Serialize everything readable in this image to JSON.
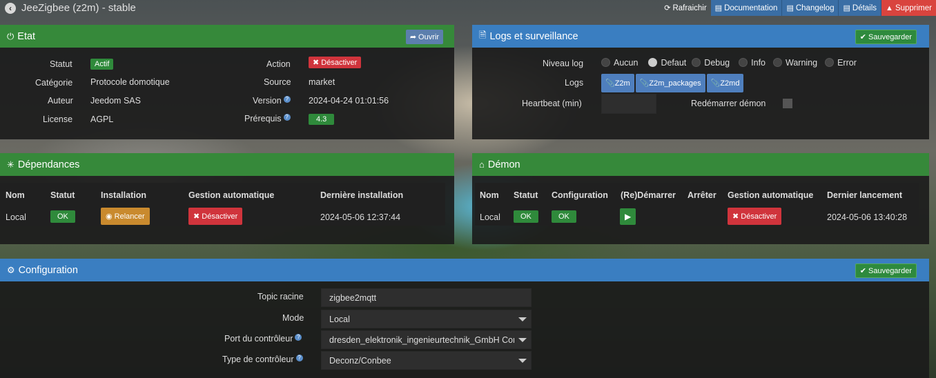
{
  "app": {
    "title": "JeeZigbee (z2m) - stable"
  },
  "toolbar": {
    "refresh": "Rafraichir",
    "documentation": "Documentation",
    "changelog": "Changelog",
    "details": "Détails",
    "delete": "Supprimer"
  },
  "etat": {
    "title": "Etat",
    "open_button": "Ouvrir",
    "statut_label": "Statut",
    "statut_value": "Actif",
    "categorie_label": "Catégorie",
    "categorie_value": "Protocole domotique",
    "auteur_label": "Auteur",
    "auteur_value": "Jeedom SAS",
    "license_label": "License",
    "license_value": "AGPL",
    "action_label": "Action",
    "action_button": "Désactiver",
    "source_label": "Source",
    "source_value": "market",
    "version_label": "Version",
    "version_value": "2024-04-24 01:01:56",
    "prerequis_label": "Prérequis",
    "prerequis_value": "4.3"
  },
  "logs": {
    "title": "Logs et surveillance",
    "save_button": "Sauvegarder",
    "niveau_label": "Niveau log",
    "levels": [
      "Aucun",
      "Defaut",
      "Debug",
      "Info",
      "Warning",
      "Error"
    ],
    "selected_level": "Defaut",
    "logs_label": "Logs",
    "log_buttons": [
      "Z2m",
      "Z2m_packages",
      "Z2md"
    ],
    "heartbeat_label": "Heartbeat (min)",
    "heartbeat_value": "",
    "restart_label": "Redémarrer démon"
  },
  "dependances": {
    "title": "Dépendances",
    "headers": [
      "Nom",
      "Statut",
      "Installation",
      "Gestion automatique",
      "Dernière installation"
    ],
    "row": {
      "nom": "Local",
      "statut": "OK",
      "installation": "Relancer",
      "gestion": "Désactiver",
      "derniere": "2024-05-06 12:37:44"
    }
  },
  "demon": {
    "title": "Démon",
    "headers": [
      "Nom",
      "Statut",
      "Configuration",
      "(Re)Démarrer",
      "Arrêter",
      "Gestion automatique",
      "Dernier lancement"
    ],
    "row": {
      "nom": "Local",
      "statut": "OK",
      "configuration": "OK",
      "gestion": "Désactiver",
      "dernier": "2024-05-06 13:40:28"
    }
  },
  "configuration": {
    "title": "Configuration",
    "save_button": "Sauvegarder",
    "topic_label": "Topic racine",
    "topic_value": "zigbee2mqtt",
    "mode_label": "Mode",
    "mode_value": "Local",
    "port_label": "Port du contrôleur",
    "port_value": "dresden_elektronik_ingenieurtechnik_GmbH Cor",
    "type_label": "Type de contrôleur",
    "type_value": "Deconz/Conbee"
  }
}
